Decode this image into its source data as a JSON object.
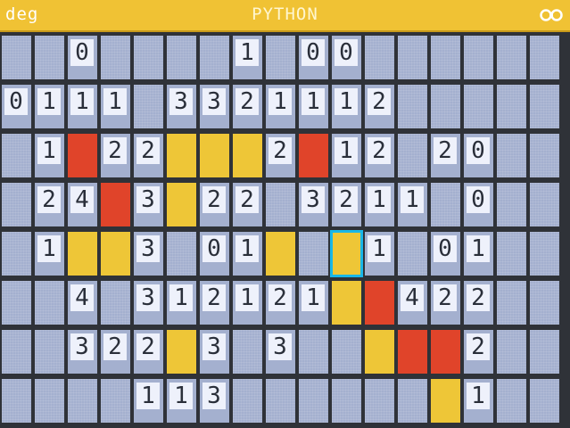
{
  "header": {
    "mode": "deg",
    "title": "PYTHON",
    "battery_icon": "battery-icon"
  },
  "colors": {
    "header": "#f0c234",
    "hidden": "#a4b0cf",
    "revealed": "#eef1fb",
    "flag": "#eec637",
    "mine": "#e0442a",
    "cursor": "#19b7e8"
  },
  "board": {
    "legend": "cells: '' = covered, 'F' = yellow, 'X' = red, digit = revealed number, ' ' = revealed blank",
    "rows": [
      [
        "",
        "",
        "0",
        "",
        "",
        "",
        "",
        "1",
        "",
        "0",
        "0",
        "",
        "",
        "",
        "",
        "",
        ""
      ],
      [
        "0",
        "1",
        "1",
        "1",
        "",
        "3",
        "3",
        "2",
        "1",
        "1",
        "1",
        "2",
        "",
        "",
        "",
        "",
        ""
      ],
      [
        "",
        "1",
        "X",
        "2",
        "2",
        "F",
        "F",
        "F",
        "2",
        "X",
        "1",
        "2",
        "",
        "2",
        "0",
        "",
        ""
      ],
      [
        "",
        "2",
        "4",
        "X",
        "3",
        "F",
        "2",
        "2",
        "",
        "3",
        "2",
        "1",
        "1",
        "",
        "0",
        "",
        ""
      ],
      [
        "",
        "1",
        "F",
        "F",
        "3",
        "",
        "0",
        "1",
        "F",
        "",
        "F",
        "1",
        "",
        "0",
        "1",
        "",
        ""
      ],
      [
        "",
        "",
        "4",
        "",
        "3",
        "1",
        "2",
        "1",
        "2",
        "1",
        "F",
        "X",
        "4",
        "2",
        "2",
        "",
        ""
      ],
      [
        "",
        "",
        "3",
        "2",
        "2",
        "F",
        "3",
        "",
        "3",
        "",
        "",
        "F",
        "X",
        "X",
        "2",
        "",
        ""
      ],
      [
        "",
        "",
        "",
        "",
        "1",
        "1",
        "3",
        "",
        "",
        "",
        "",
        "",
        "",
        "F",
        "1",
        "",
        ""
      ]
    ],
    "cursor": {
      "row": 4,
      "col": 10
    }
  }
}
